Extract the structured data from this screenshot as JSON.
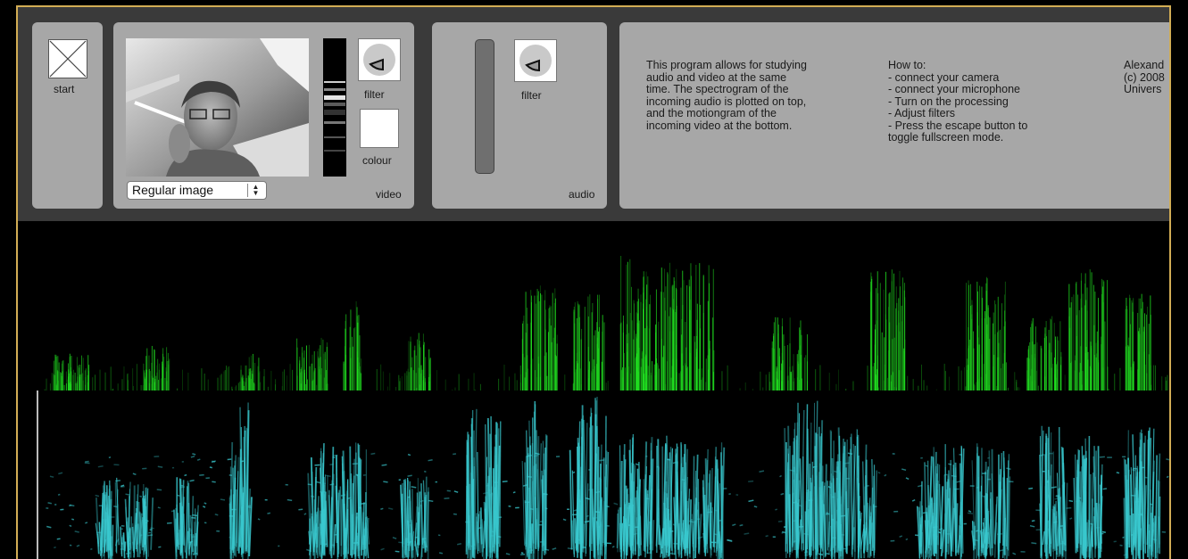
{
  "start_panel": {
    "label": "start"
  },
  "video_panel": {
    "filter_label": "filter",
    "colour_label": "colour",
    "panel_label": "video",
    "mode_select": {
      "selected": "Regular image"
    }
  },
  "audio_panel": {
    "filter_label": "filter",
    "panel_label": "audio"
  },
  "info_panel": {
    "description": "This program allows for studying\naudio and video at the same\ntime. The spectrogram of the\nincoming audio is plotted on top,\nand the motiongram of the\nincoming video at the bottom.",
    "howto": "How to:\n- connect your camera\n- connect your microphone\n- Turn on the processing\n- Adjust filters\n- Press the escape button to\ntoggle fullscreen mode.",
    "credits": "Alexand\n(c) 2008\nUnivers"
  },
  "colors": {
    "frame_border": "#d2ad55",
    "panel_bg": "#a7a7a7",
    "background": "#3a3a3a",
    "spectrogram": "#22e622",
    "motiongram": "#39c9cf"
  }
}
